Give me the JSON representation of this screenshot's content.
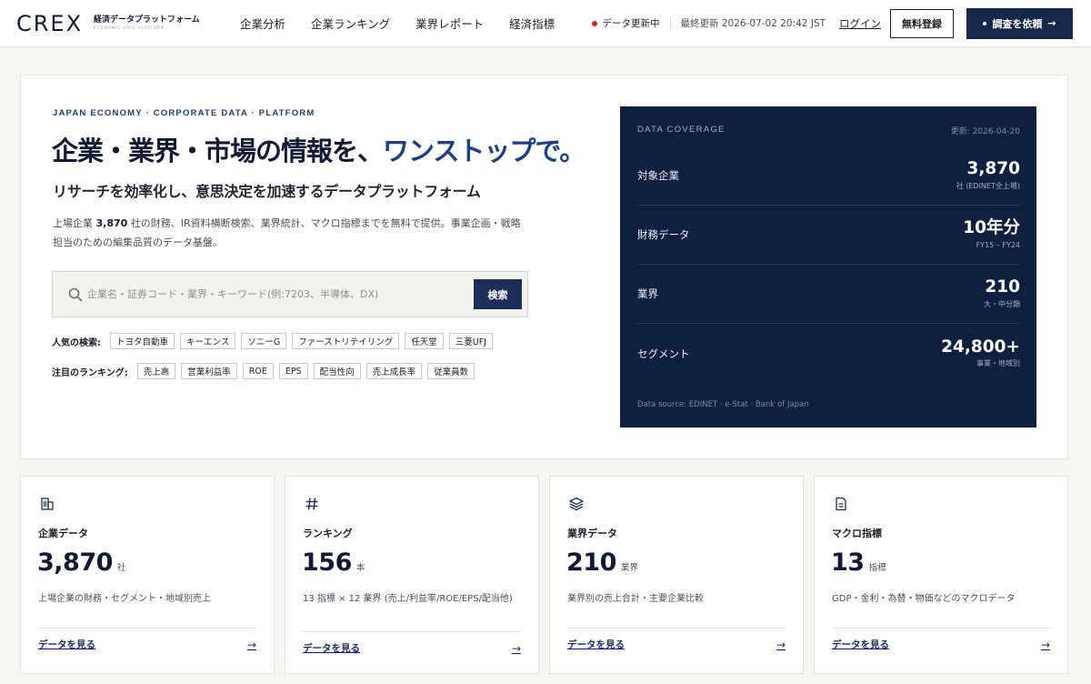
{
  "header": {
    "logo_mark": "CREX",
    "logo_jp": "経済データプラットフォーム",
    "logo_en": "ECONOMIC DATA PLATFORM",
    "nav": [
      "企業分析",
      "企業ランキング",
      "業界レポート",
      "経済指標"
    ],
    "live_status": "データ更新中",
    "last_updated": "最終更新 2026-07-02 20:42 JST",
    "login": "ログイン",
    "register": "無料登録",
    "request": "調査を依頼",
    "request_arrow": "→"
  },
  "hero": {
    "eyebrow": "JAPAN ECONOMY · CORPORATE DATA · PLATFORM",
    "headline_main": "企業・業界・市場の情報を、",
    "headline_accent": "ワンストップで。",
    "subhead": "リサーチを効率化し、意思決定を加速するデータプラットフォーム",
    "desc_pre": "上場企業 ",
    "desc_bold": "3,870",
    "desc_post": " 社の財務、IR資料横断検索、業界統計、マクロ指標までを無料で提供。事業企画・戦略担当のための編集品質のデータ基盤。",
    "search_placeholder": "企業名・証券コード・業界・キーワード(例:7203、半導体、DX)",
    "search_button": "検索",
    "popular_label": "人気の検索:",
    "popular": [
      "トヨタ自動車",
      "キーエンス",
      "ソニーG",
      "ファーストリテイリング",
      "任天堂",
      "三菱UFJ"
    ],
    "ranking_label": "注目のランキング:",
    "rankings": [
      "売上高",
      "営業利益率",
      "ROE",
      "EPS",
      "配当性向",
      "売上成長率",
      "従業員数"
    ]
  },
  "coverage": {
    "title": "DATA COVERAGE",
    "date": "更新: 2026-04-20",
    "rows": [
      {
        "label": "対象企業",
        "value": "3,870",
        "sub": "社 (EDINET全上場)"
      },
      {
        "label": "財務データ",
        "value": "10年分",
        "sub": "FY15 – FY24"
      },
      {
        "label": "業界",
        "value": "210",
        "sub": "大・中分類"
      },
      {
        "label": "セグメント",
        "value": "24,800+",
        "sub": "事業・地域別"
      }
    ],
    "source": "Data source: EDINET · e-Stat · Bank of Japan"
  },
  "cards": [
    {
      "icon": "building-icon",
      "title": "企業データ",
      "value": "3,870",
      "unit": "社",
      "desc": "上場企業の財務・セグメント・地域別売上",
      "link": "データを見る",
      "arrow": "→"
    },
    {
      "icon": "hash-icon",
      "title": "ランキング",
      "value": "156",
      "unit": "本",
      "desc": "13 指標 × 12 業界 (売上/利益率/ROE/EPS/配当他)",
      "link": "データを見る",
      "arrow": "→"
    },
    {
      "icon": "layers-icon",
      "title": "業界データ",
      "value": "210",
      "unit": "業界",
      "desc": "業界別の売上合計・主要企業比較",
      "link": "データを見る",
      "arrow": "→"
    },
    {
      "icon": "document-icon",
      "title": "マクロ指標",
      "value": "13",
      "unit": "指標",
      "desc": "GDP・金利・為替・物価などのマクロデータ",
      "link": "データを見る",
      "arrow": "→"
    }
  ],
  "colors": {
    "navy": "#0f1f3f",
    "accent_blue": "#1e3f80",
    "live_red": "#d11f2b",
    "background": "#f7f6f2"
  }
}
